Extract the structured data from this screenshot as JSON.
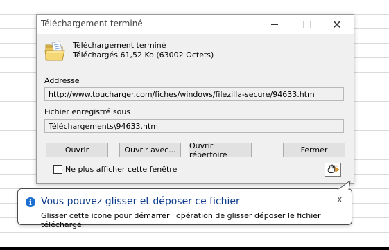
{
  "window": {
    "title": "Téléchargement terminé",
    "controls": {
      "minimize": "minimize",
      "maximize": "maximize",
      "close": "✕"
    }
  },
  "status": {
    "heading": "Téléchargement terminé",
    "size": "Téléchargés 61,52  Ko (63002 Octets)"
  },
  "address": {
    "label": "Addresse",
    "value": "http://www.toucharger.com/fiches/windows/filezilla-secure/94633.htm"
  },
  "saved": {
    "label": "Fichier enregistré sous",
    "value": "Téléchargements\\94633.htm"
  },
  "buttons": {
    "open": "Ouvrir",
    "open_with": "Ouvrir avec...",
    "open_folder": "Ouvrir répertoire",
    "close": "Fermer"
  },
  "checkbox": {
    "label": "Ne plus afficher cette fenêtre",
    "checked": false
  },
  "balloon": {
    "title": "Vous pouvez glisser et déposer ce fichier",
    "text": "Glisser cette icone pour démarrer l'opération de glisser déposer le fichier téléchargé.",
    "close": "x"
  },
  "colors": {
    "balloon_title": "#0c3b8c",
    "info_icon": "#1a6fd1",
    "button_face": "#e1e1e1"
  }
}
